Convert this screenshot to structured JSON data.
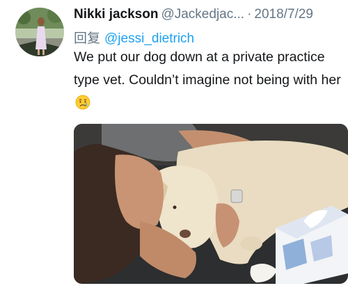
{
  "tweet": {
    "author_name": "Nikki jackson",
    "author_handle": "@Jackedjac...",
    "separator": "·",
    "date": "2018/7/29",
    "reply_label": "回复",
    "reply_to": "@jessi_dietrich",
    "text": "We put our dog down at a private practice type vet. Couldn’t imagine not being with her",
    "emoji": "crying-face-emoji"
  },
  "colors": {
    "name": "#14171a",
    "secondary": "#657786",
    "mention": "#1da1f2"
  }
}
